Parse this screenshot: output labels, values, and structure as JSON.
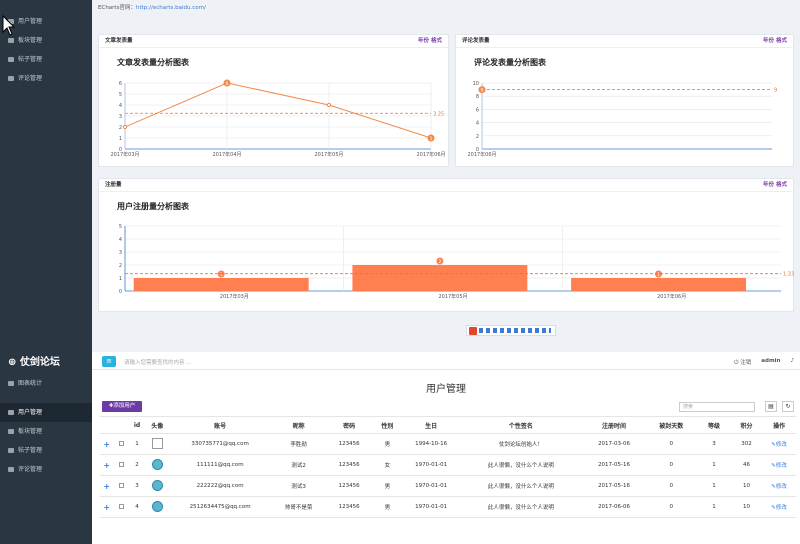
{
  "sidebar_top": {
    "items": [
      {
        "label": "用户管理",
        "icon": "users-icon"
      },
      {
        "label": "板块管理",
        "icon": "board-icon"
      },
      {
        "label": "帖子管理",
        "icon": "post-icon"
      },
      {
        "label": "评论管理",
        "icon": "comment-icon"
      }
    ]
  },
  "echarts_link": {
    "prefix": "ECharts官网：",
    "url": "http://echarts.baidu.com/"
  },
  "panels": {
    "articles": {
      "header": "文章发表量",
      "title": "文章发表量分析图表",
      "acts": [
        "年份",
        "格式"
      ]
    },
    "comments": {
      "header": "评论发表量",
      "title": "评论发表量分析图表",
      "acts": [
        "年份",
        "格式"
      ]
    },
    "users": {
      "header": "注册量",
      "title": "用户注册量分析图表",
      "acts": [
        "年份",
        "格式"
      ]
    }
  },
  "chart_data": [
    {
      "type": "line",
      "title": "文章发表量分析图表",
      "x": [
        "2017年03月",
        "2017年04月",
        "2017年05月",
        "2017年06月"
      ],
      "values": [
        2,
        6,
        4,
        1
      ],
      "ylim": [
        0,
        6
      ],
      "markline_avg": 3.25,
      "colors": {
        "line": "#f08a4b",
        "avg": "#e8732f"
      }
    },
    {
      "type": "line",
      "title": "评论发表量分析图表",
      "x": [
        "2017年06月"
      ],
      "values": [
        9
      ],
      "ylim": [
        0,
        10
      ],
      "markline_avg": 9,
      "colors": {
        "line": "#f08a4b",
        "avg": "#e8732f"
      }
    },
    {
      "type": "bar",
      "title": "用户注册量分析图表",
      "categories": [
        "2017年03月",
        "2017年05月",
        "2017年06月"
      ],
      "values": [
        1,
        2,
        1
      ],
      "ylim": [
        0,
        5
      ],
      "markline_avg": 1.33,
      "colors": {
        "bar": "#ff7f50",
        "avg": "#e8732f"
      }
    }
  ],
  "sidebar_bottom": {
    "logo": "仗剑论坛",
    "items": [
      {
        "label": "图表统计",
        "icon": "home-icon"
      },
      {
        "label": "用户管理",
        "icon": "users-icon",
        "active": true
      },
      {
        "label": "板块管理",
        "icon": "board-icon"
      },
      {
        "label": "帖子管理",
        "icon": "post-icon"
      },
      {
        "label": "评论管理",
        "icon": "comment-icon"
      }
    ]
  },
  "topbar": {
    "search_placeholder": "请输入您需要查找的内容 ...",
    "logout": "注销",
    "user": "admin"
  },
  "page": {
    "title": "用户管理",
    "add_button": "✚添加用户",
    "search_placeholder": "搜索"
  },
  "table": {
    "headers": [
      "",
      "",
      "id",
      "头像",
      "账号",
      "昵称",
      "密码",
      "性别",
      "生日",
      "个性签名",
      "注册时间",
      "被封天数",
      "等级",
      "积分",
      "操作"
    ],
    "rows": [
      {
        "id": "1",
        "account": "330735771@qq.com",
        "nick": "李胜勋",
        "pwd": "123456",
        "sex": "男",
        "birth": "1994-10-16",
        "sign": "仗剑论坛创始人！",
        "reg": "2017-03-06",
        "ban": "0",
        "level": "3",
        "score": "302",
        "op": "修改"
      },
      {
        "id": "2",
        "account": "111111@qq.com",
        "nick": "测试2",
        "pwd": "123456",
        "sex": "女",
        "birth": "1970-01-01",
        "sign": "此人很懒，没什么个人说明",
        "reg": "2017-05-16",
        "ban": "0",
        "level": "1",
        "score": "46",
        "op": "修改"
      },
      {
        "id": "3",
        "account": "222222@qq.com",
        "nick": "测试3",
        "pwd": "123456",
        "sex": "男",
        "birth": "1970-01-01",
        "sign": "此人很懒，没什么个人说明",
        "reg": "2017-05-16",
        "ban": "0",
        "level": "1",
        "score": "10",
        "op": "修改"
      },
      {
        "id": "4",
        "account": "2512634475@qq.com",
        "nick": "帅哥不是菜",
        "pwd": "123456",
        "sex": "男",
        "birth": "1970-01-01",
        "sign": "此人很懒，没什么个人说明",
        "reg": "2017-06-06",
        "ban": "0",
        "level": "1",
        "score": "10",
        "op": "修改"
      }
    ]
  }
}
